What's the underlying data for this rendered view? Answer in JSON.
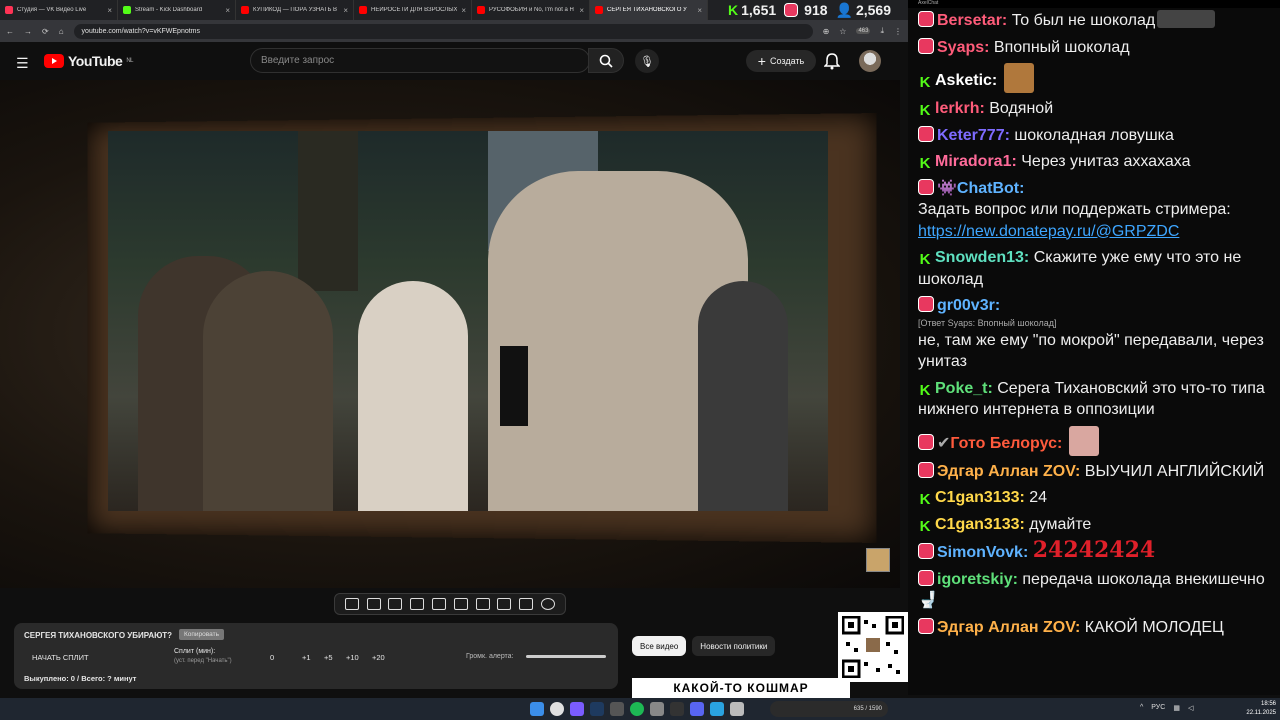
{
  "browser": {
    "tabs": [
      {
        "title": "Студия — VK Видео Live",
        "color": "#ff3355"
      },
      {
        "title": "Stream - Kick Dashboard",
        "color": "#53fc18"
      },
      {
        "title": "КУПИКОД — ПОРА УЗНАТЬ В",
        "color": "#ff0000"
      },
      {
        "title": "НЕЙРОСЕТИ ДЛЯ ВЗРОСЛЫХ",
        "color": "#ff0000"
      },
      {
        "title": "РУСОФОБИЯ и No, I'm not a H",
        "color": "#ff0000"
      },
      {
        "title": "СЕРГЕЯ ТИХАНОВСКОГО У",
        "color": "#ff0000",
        "active": true
      }
    ],
    "url": "youtube.com/watch?v=vKFWEpnotms",
    "ext_badge": "463"
  },
  "stream_stats": {
    "kick": "1,651",
    "vk": "918",
    "viewers": "2,569"
  },
  "youtube": {
    "logo": "YouTube",
    "region": "NL",
    "search_placeholder": "Введите запрос",
    "create_label": "Создать"
  },
  "split": {
    "title": "СЕРГЕЯ ТИХАНОВСКОГО УБИРАЮТ?",
    "copy_label": "Копировать",
    "start_label": "НАЧАТЬ СПЛИТ",
    "split_min_label": "Сплит (мин):",
    "split_hint": "(уст. перед \"Начать\")",
    "value": "0",
    "increments": [
      "+1",
      "+5",
      "+10",
      "+20"
    ],
    "volume_label": "Громк. алерта:",
    "bought": "Выкуплено: 0 / Всего: ? минут"
  },
  "chips": [
    "Все видео",
    "Новости политики"
  ],
  "banner": "КАКОЙ-ТО КОШМАР",
  "chat": {
    "header": "AxelChat",
    "messages": [
      {
        "src": "vk",
        "nick": "Bersetar:",
        "color": "#ff5c7a",
        "text": "То был не шоколад",
        "emote": "#333"
      },
      {
        "src": "vk",
        "nick": "Syaps:",
        "color": "#ff5c7a",
        "text": "Впопный шоколад"
      },
      {
        "src": "kick",
        "nick": "Asketic:",
        "color": "#fff",
        "text": "",
        "emote": "#b0783c"
      },
      {
        "src": "kick",
        "nick": "lerkrh:",
        "color": "#ff5c7a",
        "text": "Водяной"
      },
      {
        "src": "vk",
        "nick": "Keter777:",
        "color": "#7e6bff",
        "text": "шоколадная ловушка"
      },
      {
        "src": "kick",
        "nick": "Miradora1:",
        "color": "#ff6b9a",
        "text": "Через унитаз аххахаха"
      },
      {
        "src": "vk",
        "nick": "👾ChatBot:",
        "color": "#5fb3ff",
        "text": "Задать вопрос или поддержать стримера:",
        "link": "https://new.donatepay.ru/@GRPZDC"
      },
      {
        "src": "kick",
        "nick": "Snowden13:",
        "color": "#5fe0c0",
        "text": "Скажите уже ему что это не шоколад"
      },
      {
        "src": "vk",
        "nick": "gr00v3r:",
        "color": "#5fb3ff",
        "reply": "[Ответ Syaps: Впопный шоколад]",
        "text": "не, там же ему \"по мокрой\" передавали, через унитаз"
      },
      {
        "src": "kick",
        "nick": "Poke_t:",
        "color": "#5fe07a",
        "text": "Серега Тихановский это что-то типа нижнего интернета в оппозиции"
      },
      {
        "src": "vk",
        "nick": "Гото Белорус:",
        "color": "#ff5a3c",
        "text": "",
        "emote": "#d9a7a0"
      },
      {
        "src": "vk",
        "nick": "Эдгар Аллан ZOV:",
        "color": "#ffb14a",
        "text": "ВЫУЧИЛ АНГЛИЙСКИЙ"
      },
      {
        "src": "kick",
        "nick": "C1gan3133:",
        "color": "#ffd84a",
        "text": "24"
      },
      {
        "src": "kick",
        "nick": "C1gan3133:",
        "color": "#ffd84a",
        "text": "думайте"
      },
      {
        "src": "vk",
        "nick": "SimonVovk:",
        "color": "#5fb3ff",
        "text": "",
        "big": "24242424"
      },
      {
        "src": "vk",
        "nick": "igoretskiy:",
        "color": "#5fe07a",
        "text": "передача шоколада внекишечно"
      },
      {
        "src": "vk",
        "nick": "Эдгар Аллан ZOV:",
        "color": "#ffb14a",
        "text": "КАКОЙ МОЛОДЕЦ"
      }
    ]
  },
  "taskbar": {
    "lang": "РУС",
    "time": "18:56",
    "date": "22.11.2025",
    "donate": "635 / 1590"
  }
}
